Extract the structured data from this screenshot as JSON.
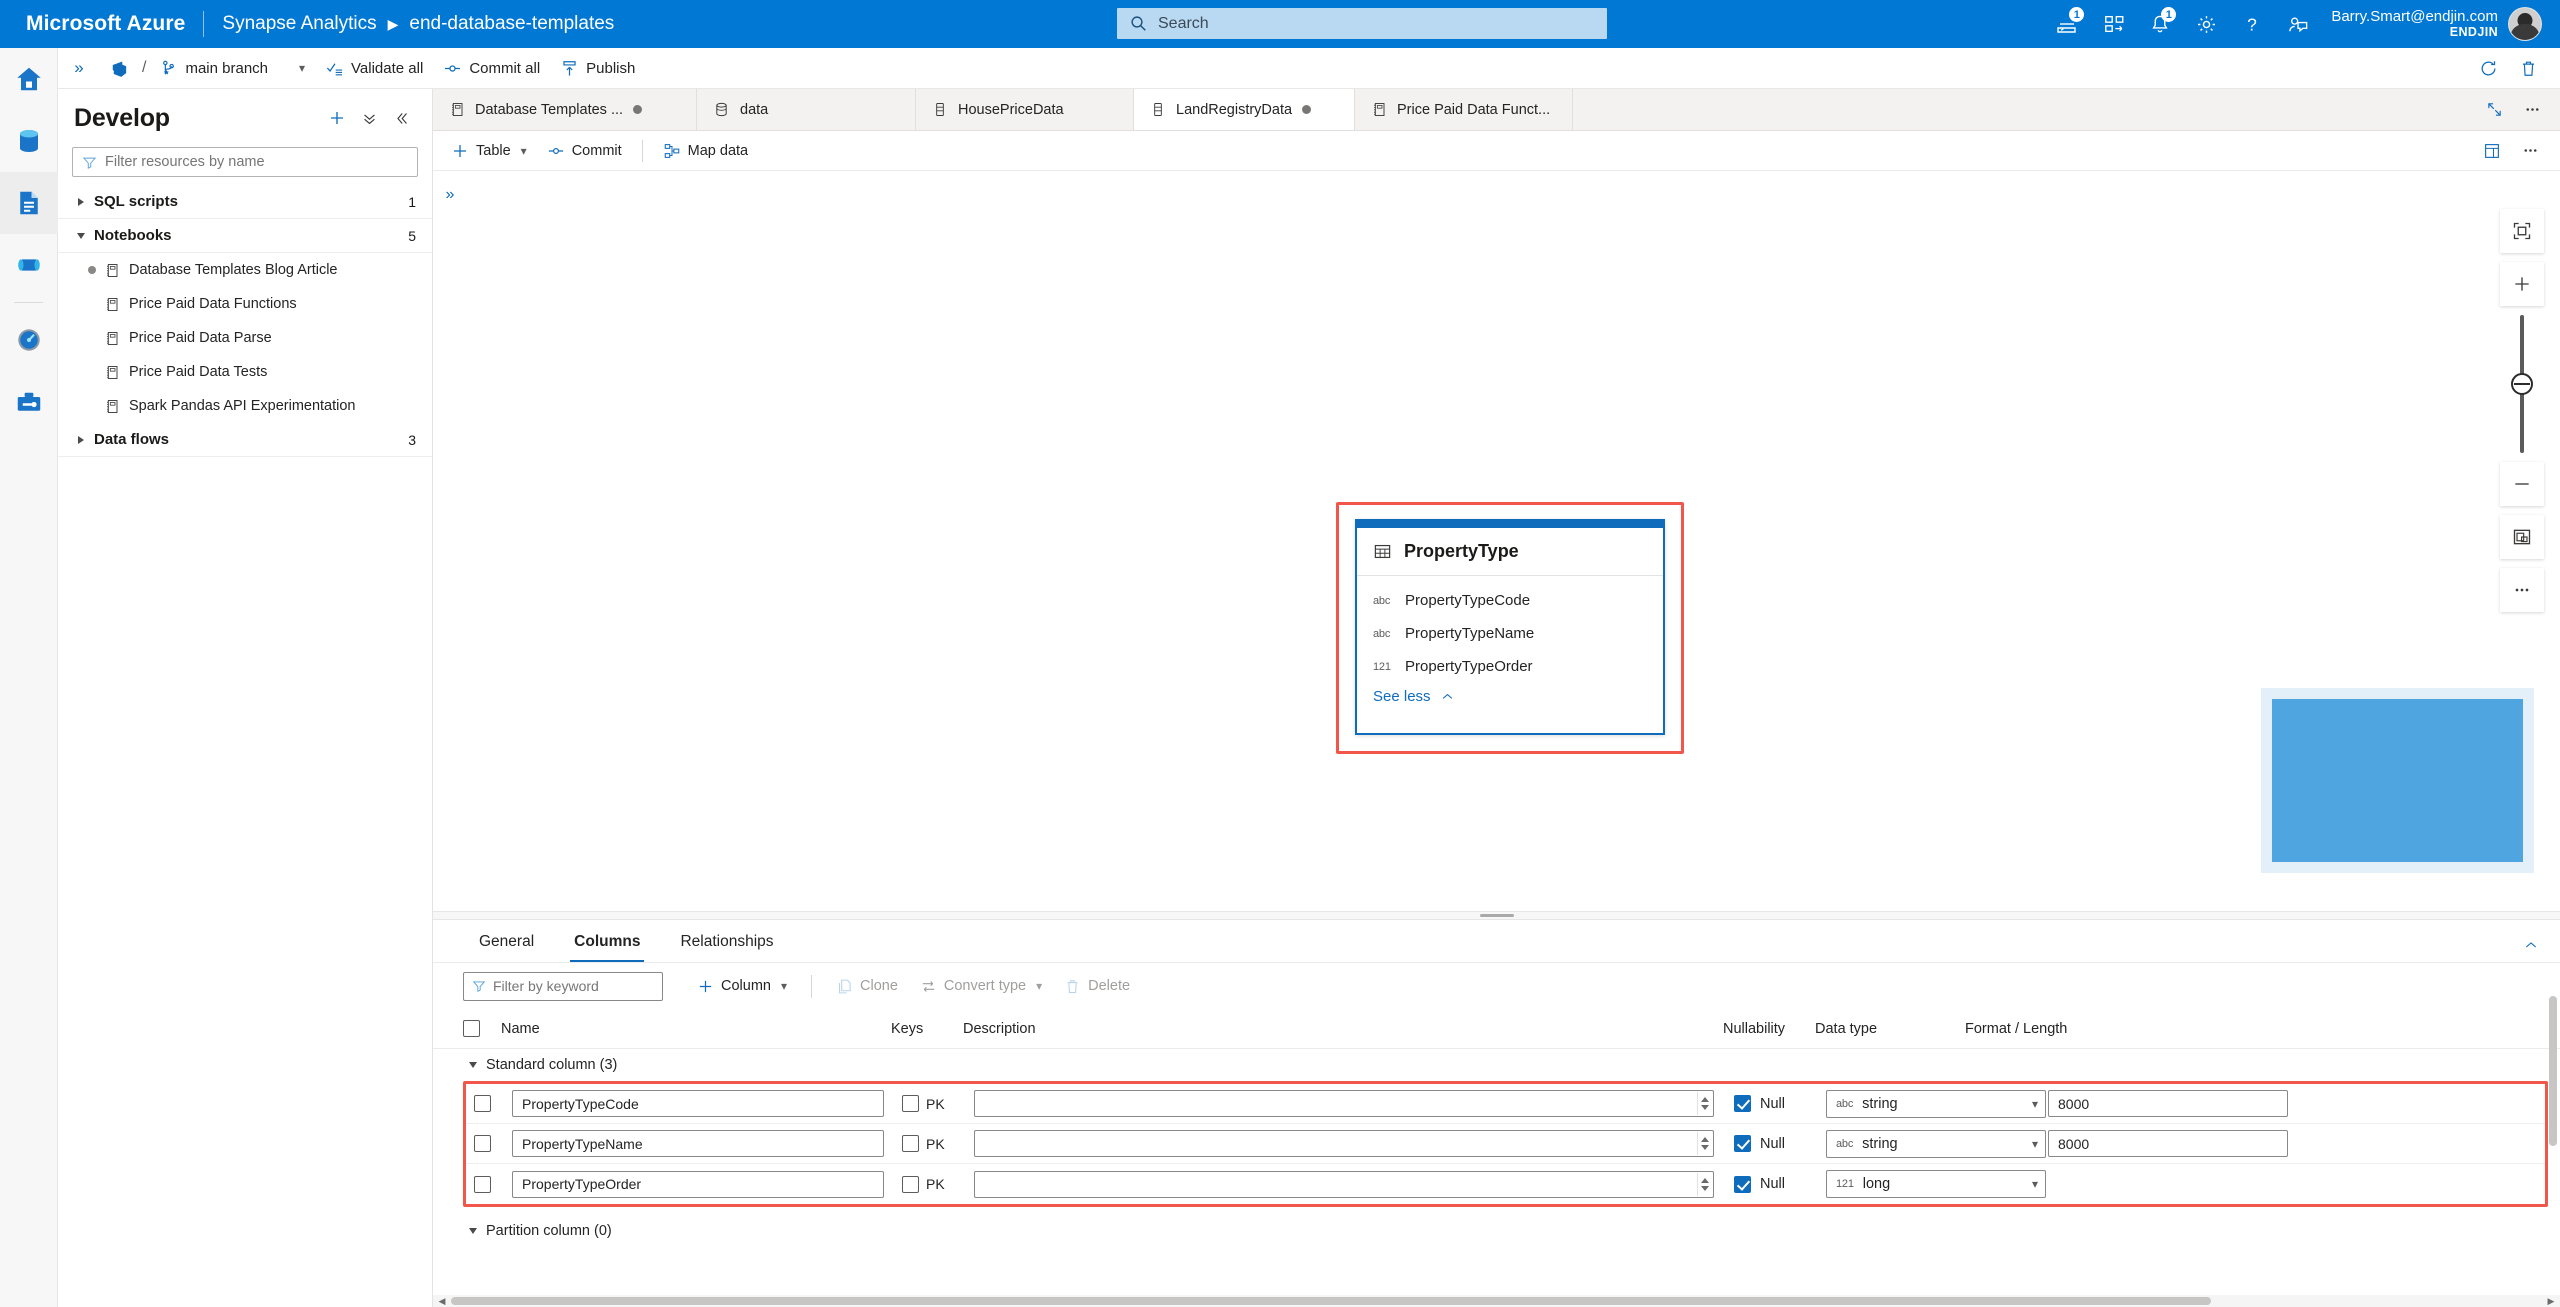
{
  "header": {
    "brand": "Microsoft Azure",
    "breadcrumb": [
      "Synapse Analytics",
      "end-database-templates"
    ],
    "search_placeholder": "Search",
    "cloudshell_badge": "1",
    "notifications_badge": "1",
    "user_name": "Barry.Smart@endjin.com",
    "user_tenant": "ENDJIN",
    "icons": {
      "cloudshell": "cloud-shell-icon",
      "directories": "directories-subscriptions-icon",
      "notifications": "bell-icon",
      "settings": "gear-icon",
      "help": "question-mark-icon",
      "feedback": "feedback-icon"
    }
  },
  "rail": {
    "items": [
      {
        "name": "home",
        "label": "Home"
      },
      {
        "name": "data",
        "label": "Data"
      },
      {
        "name": "develop",
        "label": "Develop",
        "active": true
      },
      {
        "name": "integrate",
        "label": "Integrate"
      },
      {
        "name": "monitor",
        "label": "Monitor"
      },
      {
        "name": "manage",
        "label": "Manage"
      }
    ]
  },
  "cmdbar": {
    "repo_icon": "azure-devops-icon",
    "slash": "/",
    "branch_icon": "git-branch-icon",
    "branch": "main branch",
    "validate_all": "Validate all",
    "commit_all": "Commit all",
    "publish": "Publish",
    "refresh_icon": "refresh-icon",
    "bin_icon": "discard-icon"
  },
  "develop": {
    "title": "Develop",
    "filter_placeholder": "Filter resources by name",
    "add_icon": "plus-icon",
    "collapse_all_icon": "double-chevron-down-icon",
    "hide_panel_icon": "double-chevron-left-icon",
    "groups": [
      {
        "label": "SQL scripts",
        "count": "1",
        "expanded": false,
        "items": []
      },
      {
        "label": "Notebooks",
        "count": "5",
        "expanded": true,
        "items": [
          {
            "label": "Database Templates Blog Article",
            "modified": true
          },
          {
            "label": "Price Paid Data Functions",
            "modified": false
          },
          {
            "label": "Price Paid Data Parse",
            "modified": false
          },
          {
            "label": "Price Paid Data Tests",
            "modified": false
          },
          {
            "label": "Spark Pandas API Experimentation",
            "modified": false
          }
        ]
      },
      {
        "label": "Data flows",
        "count": "3",
        "expanded": false,
        "items": []
      }
    ]
  },
  "tabs": [
    {
      "label": "Database Templates ...",
      "icon": "notebook-icon",
      "modified": true,
      "active": false
    },
    {
      "label": "data",
      "icon": "database-icon",
      "modified": false,
      "active": false
    },
    {
      "label": "HousePriceData",
      "icon": "table-icon",
      "modified": false,
      "active": false
    },
    {
      "label": "LandRegistryData",
      "icon": "table-icon",
      "modified": true,
      "active": true
    },
    {
      "label": "Price Paid Data Funct...",
      "icon": "notebook-icon",
      "modified": false,
      "active": false
    }
  ],
  "tabstrip_actions": {
    "expand_icon": "expand-diagonal-icon",
    "more_icon": "ellipsis-icon"
  },
  "subbar": {
    "table": "Table",
    "commit": "Commit",
    "map_data": "Map data",
    "properties_icon": "properties-icon",
    "more_icon": "ellipsis-icon"
  },
  "canvas": {
    "collapse_icon": "double-chevron-right-icon",
    "entity": {
      "icon": "table-grid-icon",
      "name": "PropertyType",
      "columns": [
        {
          "type_code": "abc",
          "name": "PropertyTypeCode"
        },
        {
          "type_code": "abc",
          "name": "PropertyTypeName"
        },
        {
          "type_code": "121",
          "name": "PropertyTypeOrder"
        }
      ],
      "see_less": "See less",
      "see_less_icon": "chevron-up-icon"
    },
    "zoom_rail": [
      {
        "name": "fit-to-screen-button",
        "icon": "fit-screen-icon"
      },
      {
        "name": "zoom-in-button",
        "icon": "plus-icon"
      },
      {
        "name": "zoom-slider",
        "icon": "slider-handle-icon"
      },
      {
        "name": "zoom-out-button",
        "icon": "minus-icon"
      },
      {
        "name": "minimap-toggle-button",
        "icon": "minimap-icon"
      },
      {
        "name": "canvas-more-button",
        "icon": "ellipsis-icon"
      }
    ],
    "minimap_label": "minimap"
  },
  "properties": {
    "tabs": [
      {
        "label": "General",
        "active": false
      },
      {
        "label": "Columns",
        "active": true
      },
      {
        "label": "Relationships",
        "active": false
      }
    ],
    "collapse_icon": "chevron-up-icon",
    "toolbar": {
      "filter_placeholder": "Filter by keyword",
      "column": "Column",
      "clone": "Clone",
      "convert_type": "Convert type",
      "delete": "Delete"
    },
    "grid_headers": {
      "name": "Name",
      "keys": "Keys",
      "description": "Description",
      "nullability": "Nullability",
      "data_type": "Data type",
      "format_length": "Format / Length"
    },
    "groups": [
      {
        "label": "Standard column (3)",
        "expanded": true
      },
      {
        "label": "Partition column (0)",
        "expanded": true
      }
    ],
    "rows": [
      {
        "selected": false,
        "name": "PropertyTypeCode",
        "pk_label": "PK",
        "pk": false,
        "description": "",
        "null_label": "Null",
        "nullable": true,
        "type_code": "abc",
        "type_name": "string",
        "format_length": "8000"
      },
      {
        "selected": false,
        "name": "PropertyTypeName",
        "pk_label": "PK",
        "pk": false,
        "description": "",
        "null_label": "Null",
        "nullable": true,
        "type_code": "abc",
        "type_name": "string",
        "format_length": "8000"
      },
      {
        "selected": false,
        "name": "PropertyTypeOrder",
        "pk_label": "PK",
        "pk": false,
        "description": "",
        "null_label": "Null",
        "nullable": true,
        "type_code": "121",
        "type_name": "long",
        "format_length": ""
      }
    ]
  },
  "colors": {
    "azure_blue": "#0078d4",
    "accent_link": "#0f6cbd",
    "highlight_red": "#f2564b",
    "minimap_view": "#4ea5e0",
    "minimap_bg": "#e3f0fa"
  }
}
